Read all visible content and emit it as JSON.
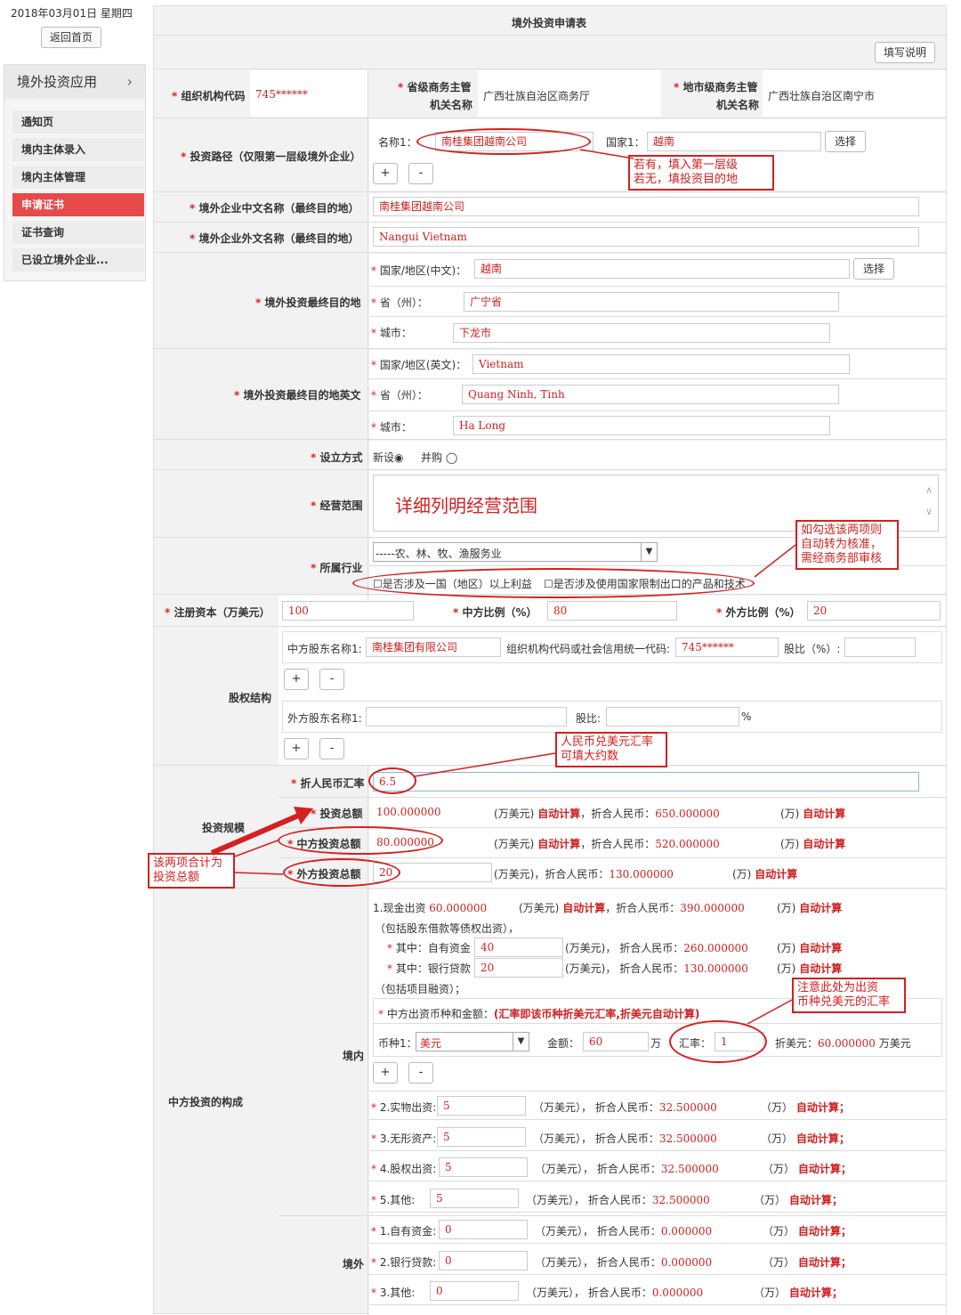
{
  "header": {
    "date": "2018年03月01日 星期四",
    "home_button": "返回首页"
  },
  "sidebar": {
    "title": "境外投资应用",
    "items": [
      "通知页",
      "境内主体录入",
      "境内主体管理",
      "申请证书",
      "证书查询",
      "已设立境外企业..."
    ]
  },
  "form": {
    "title": "境外投资申请表",
    "help_button": "填写说明",
    "org_code": {
      "label": "组织机构代码",
      "value": "745******"
    },
    "prov_authority": {
      "label_line1": "省级商务主管",
      "label_line2": "机关名称",
      "value": "广西壮族自治区商务厅"
    },
    "city_authority": {
      "label_line1": "地市级商务主管",
      "label_line2": "机关名称",
      "value": "广西壮族自治区南宁市"
    },
    "path": {
      "label": "投资路径（仅限第一层级境外企业）",
      "name_label": "名称1：",
      "name_value": "南桂集团越南公司",
      "country_label": "国家1：",
      "country_value": "越南",
      "select_button": "选择",
      "plus": "+",
      "minus": "-"
    },
    "cn_name": {
      "label": "境外企业中文名称（最终目的地）",
      "value": "南桂集团越南公司"
    },
    "en_name": {
      "label": "境外企业外文名称（最终目的地）",
      "value": "Nangui Vietnam"
    },
    "dest_cn": {
      "label": "境外投资最终目的地",
      "country_label": "国家/地区(中文)：",
      "country_value": "越南",
      "select_button": "选择",
      "province_label": "省（州）：",
      "province_value": "广宁省",
      "city_label": "城市：",
      "city_value": "下龙市"
    },
    "dest_en": {
      "label": "境外投资最终目的地英文",
      "country_label": "国家/地区(英文)：",
      "country_value": "Vietnam",
      "province_label": "省（州）：",
      "province_value": "Quang Ninh, Tinh",
      "city_label": "城市：",
      "city_value": "Ha Long"
    },
    "setup": {
      "label": "设立方式",
      "opt1": "新设",
      "opt2": "并购"
    },
    "scope": {
      "label": "经营范围",
      "value": "详细列明经营范围"
    },
    "industry": {
      "label": "所属行业",
      "value": "-----农、林、牧、渔服务业",
      "check1": "是否涉及一国（地区）以上利益",
      "check2": "是否涉及使用国家限制出口的产品和技术"
    },
    "capital": {
      "label": "注册资本（万美元）",
      "value": "100",
      "cn_ratio_label": "中方比例（%）",
      "cn_ratio": "80",
      "fr_ratio_label": "外方比例（%）",
      "fr_ratio": "20"
    },
    "equity": {
      "label": "股权结构",
      "cn_name_label": "中方股东名称1:",
      "cn_name_value": "南桂集团有限公司",
      "code_label": "组织机构代码或社会信用统一代码:",
      "code_value": "745******",
      "share_label": "股比（%）:",
      "fr_name_label": "外方股东名称1:",
      "fr_share_label": "股比:",
      "percent": "%"
    },
    "scale": {
      "label": "投资规模",
      "rate_label": "折人民币汇率",
      "rate_value": "6.5",
      "total_label": "投资总额",
      "total_value": "100.000000",
      "cn_label": "中方投资总额",
      "cn_value": "80.000000",
      "fr_label": "外方投资总额",
      "fr_value": "20",
      "wan_usd": "(万美元)",
      "auto": "自动计算",
      "to_rmb": "，折合人民币：",
      "wan": "(万)",
      "total_rmb": "650.000000",
      "cn_rmb": "520.000000",
      "fr_rmb": "130.000000"
    },
    "composition": {
      "label": "中方投资的构成",
      "domestic_label": "境内",
      "foreign_label": "境外",
      "cash_label": "1.现金出资",
      "cash_value": "60.000000",
      "cash_rmb": "390.000000",
      "debt_note": "（包括股东借款等债权出资），",
      "own_label": "其中：自有资金",
      "own_value": "40",
      "own_rmb": "260.000000",
      "loan_label": "其中：银行贷款",
      "loan_value": "20",
      "loan_rmb": "130.000000",
      "finance_note": "（包括项目融资）；",
      "currency_title": "中方出资币种和金额：",
      "currency_note": "(汇率即该币种折美元汇率,折美元自动计算)",
      "currency_label": "币种1：",
      "currency_value": "美元",
      "amount_label": "金额：",
      "amount_value": "60",
      "wan_unit": "万",
      "rate_label": "汇率：",
      "rate_value": "1",
      "to_usd_label": "折美元：",
      "to_usd_value": "60.000000",
      "usd_unit": "万美元",
      "wan_usd_p": "（万美元），",
      "to_rmb": "折合人民币：",
      "wan_p": "（万）",
      "auto_semi": "自动计算；",
      "domestic_rows": [
        {
          "label": "2.实物出资:",
          "value": "5",
          "rmb": "32.500000"
        },
        {
          "label": "3.无形资产:",
          "value": "5",
          "rmb": "32.500000"
        },
        {
          "label": "4.股权出资:",
          "value": "5",
          "rmb": "32.500000"
        },
        {
          "label": "5.其他:",
          "value": "5",
          "rmb": "32.500000"
        }
      ],
      "foreign_rows": [
        {
          "label": "1.自有资金:",
          "value": "0",
          "rmb": "0.000000"
        },
        {
          "label": "2.银行贷款:",
          "value": "0",
          "rmb": "0.000000"
        },
        {
          "label": "3.其他:",
          "value": "0",
          "rmb": "0.000000"
        }
      ]
    }
  },
  "annotations": {
    "layer": "若有，填入第一层级\n若无，填投资目的地",
    "approve": "如勾选该两项则\n自动转为核准，\n需经商务部审核",
    "rmb_rate": "人民币兑美元汇率\n可填大约数",
    "sum": "该两项合计为\n投资总额",
    "currency": "注意此处为出资\n币种兑美元的汇率"
  },
  "colors": {
    "accent": "#e84a4a",
    "annotation": "#d42020"
  }
}
